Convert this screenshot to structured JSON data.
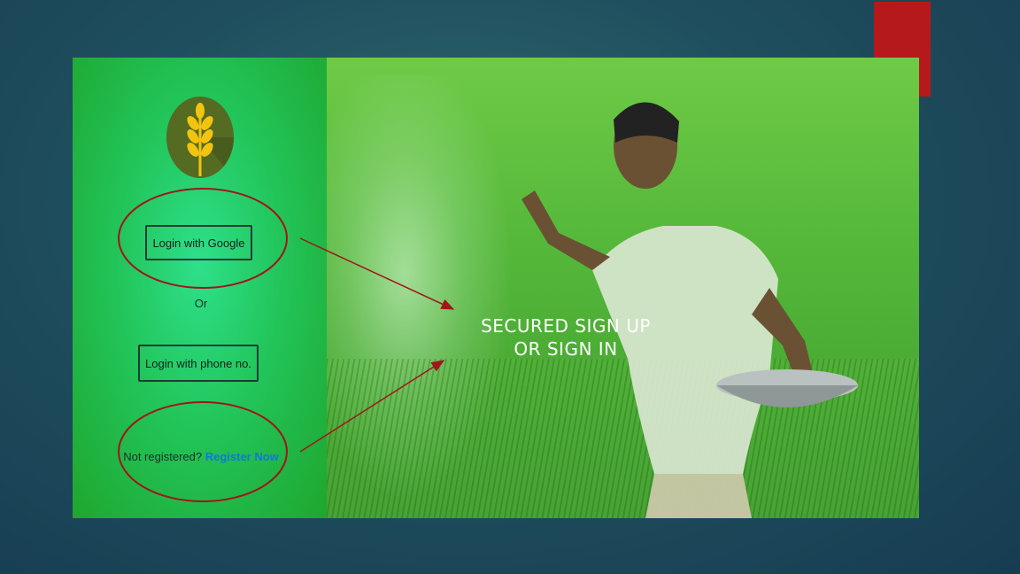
{
  "login": {
    "google_label": "Login with Google",
    "or_label": "Or",
    "phone_label": "Login with phone no.",
    "not_registered_label": "Not registered?",
    "register_label": "Register Now"
  },
  "hero": {
    "line1": "SECURED SIGN UP",
    "line2": "OR SIGN IN"
  },
  "colors": {
    "panel_green": "#22c55a",
    "accent_red": "#b5191b",
    "annotation_red": "#a0161a",
    "link_blue": "#1177dd",
    "logo_bg": "#556b22",
    "wheat_yellow": "#f2c40f"
  },
  "icons": {
    "logo": "wheat-icon"
  }
}
